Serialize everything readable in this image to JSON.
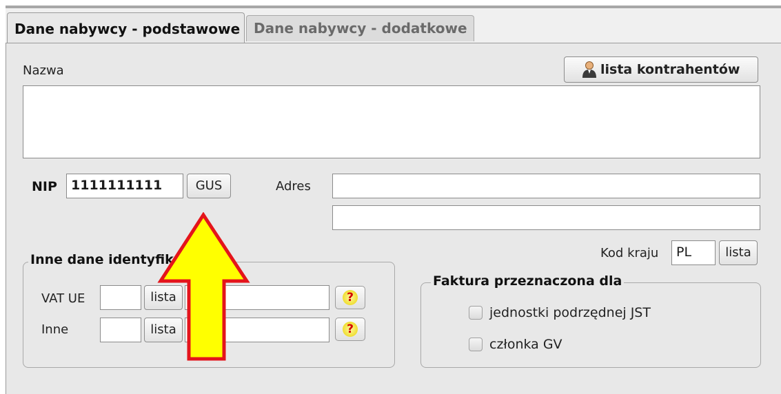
{
  "tabs": [
    {
      "label": "Dane nabywcy - podstawowe",
      "active": true
    },
    {
      "label": "Dane nabywcy - dodatkowe",
      "active": false
    }
  ],
  "name_label": "Nazwa",
  "contractor_list_button": "lista kontrahentów",
  "nip": {
    "label": "NIP",
    "value": "1111111111",
    "gus_button": "GUS"
  },
  "address_label": "Adres",
  "country": {
    "label": "Kod kraju",
    "value": "PL",
    "list_button": "lista"
  },
  "other_ids": {
    "legend": "Inne dane identyfikacyjne",
    "rows": [
      {
        "label": "VAT UE",
        "list_button": "lista"
      },
      {
        "label": "Inne",
        "list_button": "lista"
      }
    ]
  },
  "invoice_for": {
    "legend": "Faktura przeznaczona dla",
    "options": [
      {
        "label": "jednostki podrzędnej JST",
        "checked": false
      },
      {
        "label": "członka GV",
        "checked": false
      }
    ]
  },
  "colors": {
    "arrow_fill": "#ffff00",
    "arrow_stroke": "#e4141b"
  },
  "icons": {
    "help": "question-mark-icon",
    "contractors": "person-icon",
    "annotation": "arrow-up-icon"
  }
}
